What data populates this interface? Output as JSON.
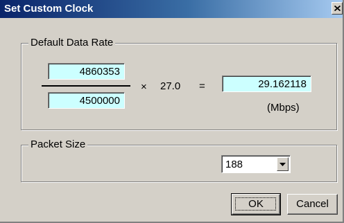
{
  "dialog": {
    "title": "Set Custom Clock",
    "close_icon": "close-icon"
  },
  "data_rate": {
    "legend": "Default Data Rate",
    "numerator": "4860353",
    "denominator": "4500000",
    "multiply_sign": "×",
    "multiplier": "27.0",
    "equals_sign": "=",
    "result": "29.162118",
    "unit": "(Mbps)"
  },
  "packet_size": {
    "legend": "Packet Size",
    "selected": "188",
    "arrow_icon": "chevron-down-icon"
  },
  "buttons": {
    "ok_label": "OK",
    "cancel_label": "Cancel"
  },
  "colors": {
    "title_bar": "#0a246a",
    "face": "#d4d0c8",
    "field_background": "#ccffff"
  }
}
